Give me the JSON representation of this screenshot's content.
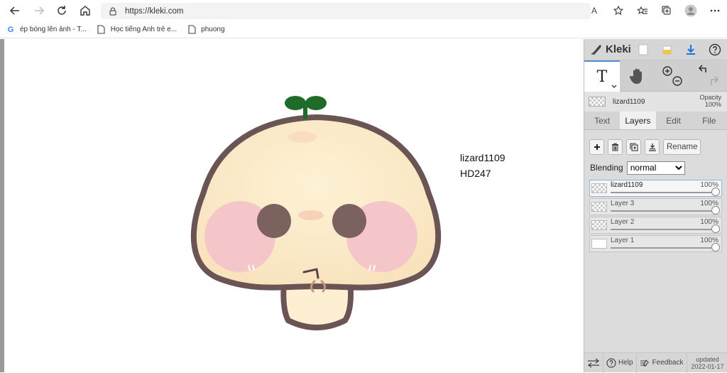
{
  "browser": {
    "url": "https://kleki.com",
    "read_aloud_icon": "A",
    "bookmarks": [
      {
        "label": "ép bóng lên ảnh - T...",
        "icon": "google-icon"
      },
      {
        "label": "Học tiếng Anh trẻ e...",
        "icon": "page-icon"
      },
      {
        "label": "phuong",
        "icon": "page-icon"
      }
    ]
  },
  "canvas": {
    "text_line1": "lizard1109",
    "text_line2": "HD247"
  },
  "panel": {
    "logo": "Kleki",
    "active_tool": "T",
    "current_layer": "lizard1109",
    "opacity_label": "Opacity",
    "opacity_value": "100%",
    "tabs": [
      "Text",
      "Layers",
      "Edit",
      "File"
    ],
    "active_tab": "Layers",
    "rename_label": "Rename",
    "blending_label": "Blending",
    "blending_value": "normal",
    "layers": [
      {
        "name": "lizard1109",
        "opacity": "100%",
        "selected": true
      },
      {
        "name": "Layer 3",
        "opacity": "100%",
        "selected": false
      },
      {
        "name": "Layer 2",
        "opacity": "100%",
        "selected": false
      },
      {
        "name": "Layer 1",
        "opacity": "100%",
        "selected": false
      }
    ],
    "footer": {
      "help": "Help",
      "feedback": "Feedback",
      "updated_label": "updated",
      "updated_date": "2022-01-17"
    }
  },
  "colors": {
    "accent": "#4a90d9",
    "panel_bg": "#dcdcdc",
    "sprout": "#1e6b2a",
    "outline": "#6a5554",
    "cheek": "#f4c5c9",
    "eye": "#7b625f",
    "face": "#fdf0cf"
  }
}
